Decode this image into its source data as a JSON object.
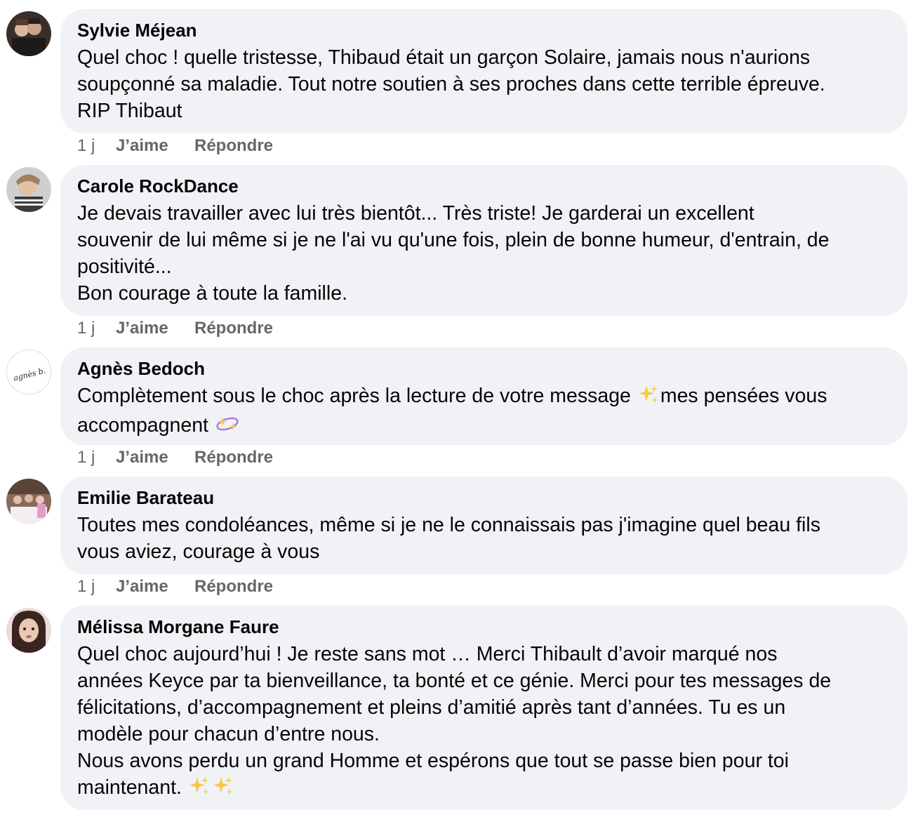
{
  "comments": [
    {
      "author": "Sylvie Méjean",
      "lines": [
        "Quel choc ! quelle tristesse, Thibaud était un garçon Solaire, jamais nous n'aurions",
        "soupçonné sa maladie. Tout notre soutien à ses proches dans cette terrible épreuve.",
        "RIP Thibaut"
      ],
      "time": "1 j",
      "like_label": "J’aime",
      "reply_label": "Répondre"
    },
    {
      "author": "Carole RockDance",
      "lines": [
        "Je devais travailler avec lui très bientôt... Très triste! Je garderai un excellent",
        "souvenir de lui même si je ne l'ai vu qu'une fois, plein de bonne humeur, d'entrain, de",
        "positivité...",
        "Bon courage à toute la famille."
      ],
      "time": "1 j",
      "like_label": "J’aime",
      "reply_label": "Répondre"
    },
    {
      "author": "Agnès Bedoch",
      "line1_before": "Complètement sous le choc après la lecture de votre message ",
      "line1_after": "mes pensées vous",
      "line2": "accompagnent ",
      "time": "1 j",
      "like_label": "J’aime",
      "reply_label": "Répondre",
      "avatar_text": "agnès b."
    },
    {
      "author": "Emilie Barateau",
      "lines": [
        "Toutes mes condoléances, même si je ne le connaissais pas j'imagine quel beau fils",
        "vous aviez, courage à vous"
      ],
      "time": "1 j",
      "like_label": "J’aime",
      "reply_label": "Répondre"
    },
    {
      "author": "Mélissa Morgane Faure",
      "lines": [
        "Quel choc aujourd’hui ! Je reste sans mot … Merci Thibault d’avoir marqué nos",
        "années Keyce par ta bienveillance, ta bonté et ce génie. Merci pour tes messages de",
        "félicitations, d’accompagnement et pleins d’amitié après tant d’années. Tu es un",
        "modèle pour chacun d’entre nous.",
        "Nous avons perdu un grand Homme et espérons que tout se passe bien pour toi"
      ],
      "last_line": "maintenant. "
    }
  ],
  "icons": {
    "sparkles": "sparkles-icon",
    "dizzy": "dizzy-icon"
  },
  "colors": {
    "bubble": "#f0f2f5",
    "meta_text": "#65676b",
    "text": "#050505"
  }
}
